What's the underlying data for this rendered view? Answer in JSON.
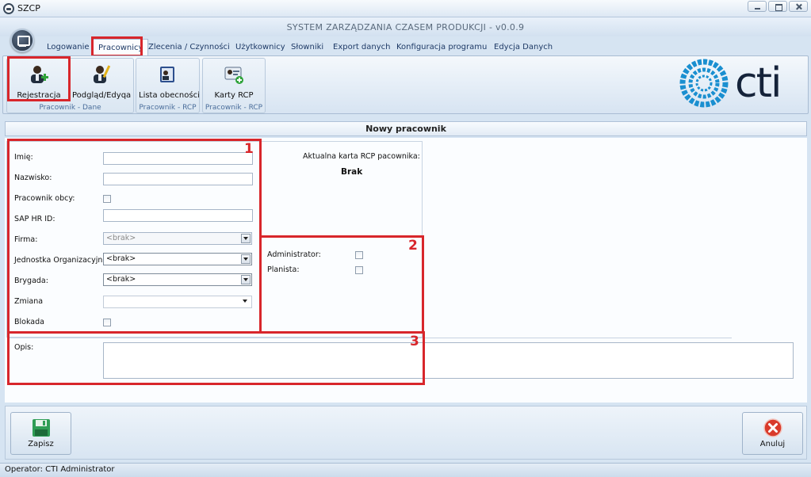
{
  "window": {
    "title": "SZCP",
    "app_title": "SYSTEM  ZARZĄDZANIA CZASEM  PRODUKCJI   -  v0.0.9"
  },
  "ribbon_tabs": [
    "Logowanie",
    "Pracownicy",
    "Zlecenia / Czynności",
    "Użytkownicy",
    "Słowniki",
    "Export danych",
    "Konfiguracja programu",
    "Edycja Danych"
  ],
  "ribbon_groups": [
    {
      "label": "Pracownik - Dane",
      "buttons": [
        "Rejestracja",
        "Podgląd/Edyqa"
      ]
    },
    {
      "label": "Pracownik - RCP",
      "buttons": [
        "Lista obecności"
      ]
    },
    {
      "label": "Pracownik - RCP",
      "buttons": [
        "Karty RCP"
      ]
    }
  ],
  "logo_text": "cti",
  "form": {
    "title": "Nowy pracownik",
    "fields": {
      "imie": "Imię:",
      "nazwisko": "Nazwisko:",
      "obcy": "Pracownik obcy:",
      "sap": "SAP HR ID:",
      "firma": "Firma:",
      "jednostka": "Jednostka Organizacyjna:",
      "brygada": "Brygada:",
      "zmiana": "Zmiana",
      "blokada": "Blokada"
    },
    "selects": {
      "firma": "<brak>",
      "jednostka": "<brak>",
      "brygada": "<brak>",
      "zmiana": ""
    },
    "rcp_card_label": "Aktualna karta RCP pacownika:",
    "rcp_card_value": "Brak",
    "roles": {
      "admin": "Administrator:",
      "planista": "Planista:"
    },
    "opis_label": "Opis:"
  },
  "annotations": [
    "1",
    "2",
    "3"
  ],
  "buttons": {
    "save": "Zapisz",
    "cancel": "Anuluj"
  },
  "status": "Operator: CTI Administrator",
  "colors": {
    "accent_red": "#d8262b",
    "ribbon_blue": "#1e3a66",
    "logo_blue": "#1a8fd0"
  }
}
